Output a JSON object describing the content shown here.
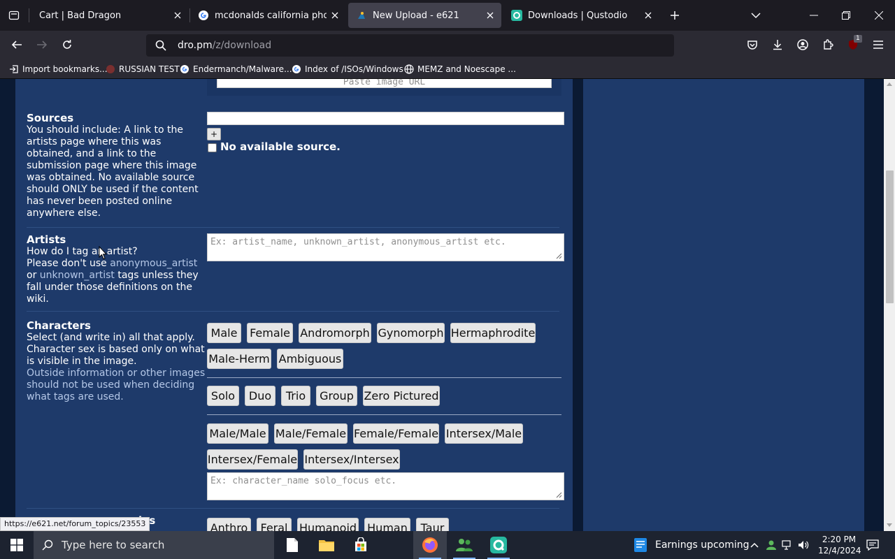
{
  "browser": {
    "tabs": [
      {
        "title": "Cart | Bad Dragon",
        "active": false
      },
      {
        "title": "mcdonalds california phone num",
        "active": false
      },
      {
        "title": "New Upload - e621",
        "active": true
      },
      {
        "title": "Downloads | Qustodio",
        "active": false
      }
    ],
    "url": {
      "host": "dro.pm",
      "path": "/z/download"
    },
    "extension_badge": "1",
    "bookmarks": [
      {
        "label": "Import bookmarks..."
      },
      {
        "label": "RUSSIAN TEST"
      },
      {
        "label": "Endermanch/Malware..."
      },
      {
        "label": "Index of /ISOs/Windows"
      },
      {
        "label": "MEMZ and Noescape ..."
      }
    ],
    "status_url": "https://e621.net/forum_topics/23553"
  },
  "upload": {
    "image_url_placeholder": "Paste image URL",
    "sources": {
      "title": "Sources",
      "description": "You should include: A link to the artists page where this was obtained, and a link to the submission page where this image was obtained. No available source should ONLY be used if the content has never been posted online anywhere else.",
      "add_label": "+",
      "no_source_label": "No available source."
    },
    "artists": {
      "title": "Artists",
      "howto": "How do I tag an artist?",
      "warning_pre": "Please don't use ",
      "link1": "anonymous_artist",
      "warning_mid": " or ",
      "link2": "unknown_artist",
      "warning_post": " tags unless they fall under those definitions on the wiki.",
      "placeholder": "Ex: artist_name, unknown_artist, anonymous_artist etc."
    },
    "characters": {
      "title": "Characters",
      "description": "Select (and write in) all that apply. Character sex is based only on what is visible in the image.",
      "note": "Outside information or other images should not be used when deciding what tags are used.",
      "sex_buttons": [
        "Male",
        "Female",
        "Andromorph",
        "Gynomorph",
        "Hermaphrodite",
        "Male-Herm",
        "Ambiguous"
      ],
      "count_buttons": [
        "Solo",
        "Duo",
        "Trio",
        "Group",
        "Zero Pictured"
      ],
      "pairing_buttons": [
        "Male/Male",
        "Male/Female",
        "Female/Female",
        "Intersex/Male",
        "Intersex/Female",
        "Intersex/Intersex"
      ],
      "placeholder": "Ex: character_name solo_focus etc."
    },
    "species": {
      "title_partial": "ies",
      "buttons": [
        "Anthro",
        "Feral",
        "Humanoid",
        "Human",
        "Taur"
      ]
    }
  },
  "taskbar": {
    "search_placeholder": "Type here to search",
    "news": "Earnings upcoming",
    "time": "2:20 PM",
    "date": "12/4/2024"
  }
}
